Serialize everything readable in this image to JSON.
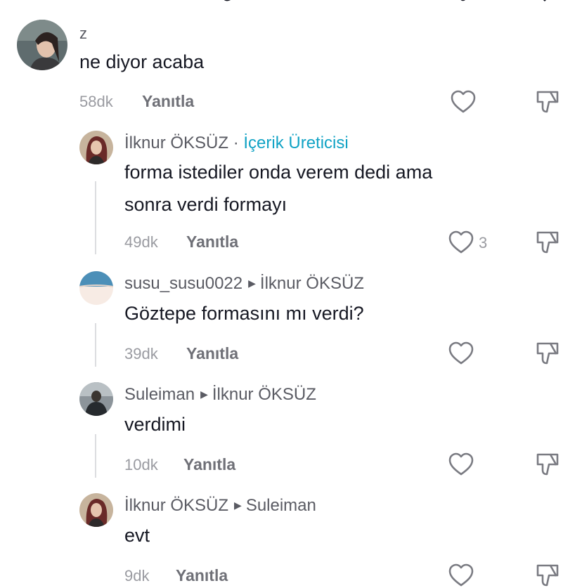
{
  "comments": [
    {
      "username": "z",
      "text": "ne diyor acaba",
      "time": "58dk",
      "reply_label": "Yanıtla",
      "likes": ""
    },
    {
      "username": "İlknur ÖKSÜZ",
      "separator": "·",
      "badge": "İçerik Üreticisi",
      "text_lines": [
        "forma istediler onda verem dedi ama",
        "sonra verdi formayı"
      ],
      "time": "49dk",
      "reply_label": "Yanıtla",
      "likes": "3"
    },
    {
      "username": "susu_susu0022",
      "reply_to": "İlknur ÖKSÜZ",
      "text": "Göztepe formasını mı verdi?",
      "time": "39dk",
      "reply_label": "Yanıtla",
      "likes": ""
    },
    {
      "username": "Suleiman",
      "reply_to": "İlknur ÖKSÜZ",
      "text": "verdimi",
      "time": "10dk",
      "reply_label": "Yanıtla",
      "likes": ""
    },
    {
      "username": "İlknur ÖKSÜZ",
      "reply_to": "Suleiman",
      "text": "evt",
      "time": "9dk",
      "reply_label": "Yanıtla",
      "likes": ""
    }
  ],
  "icons": {
    "like": "heart-outline-icon",
    "dislike": "thumbs-down-icon",
    "reply_arrow": "triangle-right-icon"
  },
  "colors": {
    "creator_badge": "#12a3c5",
    "secondary_text": "#9a9ba1",
    "primary_text": "#161823"
  }
}
